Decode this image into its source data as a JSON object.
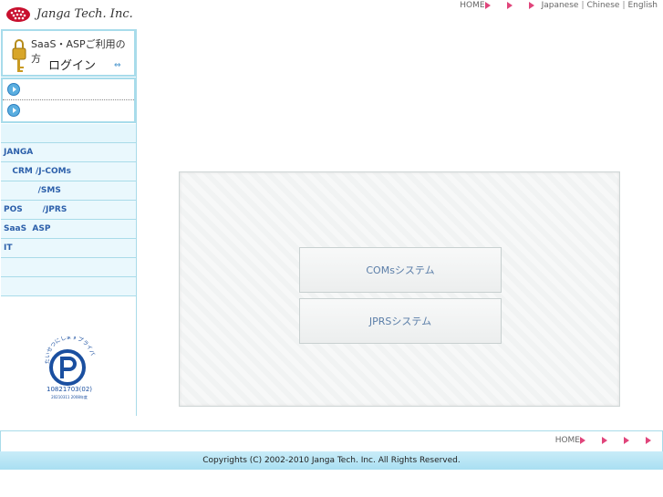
{
  "header": {
    "company": "Janga Tech. Inc.",
    "nav": {
      "home": "HOME",
      "japanese": "Japanese",
      "chinese": "Chinese",
      "english": "English",
      "separator": "|"
    }
  },
  "sidebar": {
    "login": {
      "line1": "SaaS・ASPご利用の方",
      "line2": "ログイン",
      "arrow": "⇔"
    },
    "menu": [
      {
        "label": ""
      },
      {
        "label": "JANGA"
      },
      {
        "label": "   CRM /J-COMs"
      },
      {
        "label": "            /SMS"
      },
      {
        "label": "POS       /JPRS"
      },
      {
        "label": "SaaS  ASP"
      },
      {
        "label": "IT"
      },
      {
        "label": ""
      },
      {
        "label": ""
      }
    ],
    "privacy": {
      "arc_text": "たいせつにしますプライバシー",
      "number": "10821703(02)",
      "small": "20210311 2008年度"
    }
  },
  "main": {
    "systems": [
      {
        "label": "COMsシステム"
      },
      {
        "label": "JPRSシステム"
      }
    ]
  },
  "footer": {
    "home": "HOME",
    "copyright": "Copyrights (C) 2002-2010 Janga Tech. Inc. All Rights Reserved."
  },
  "colors": {
    "accent_pink": "#e0457b",
    "menu_text": "#2c5faa",
    "border_blue": "#a9dbe9"
  }
}
